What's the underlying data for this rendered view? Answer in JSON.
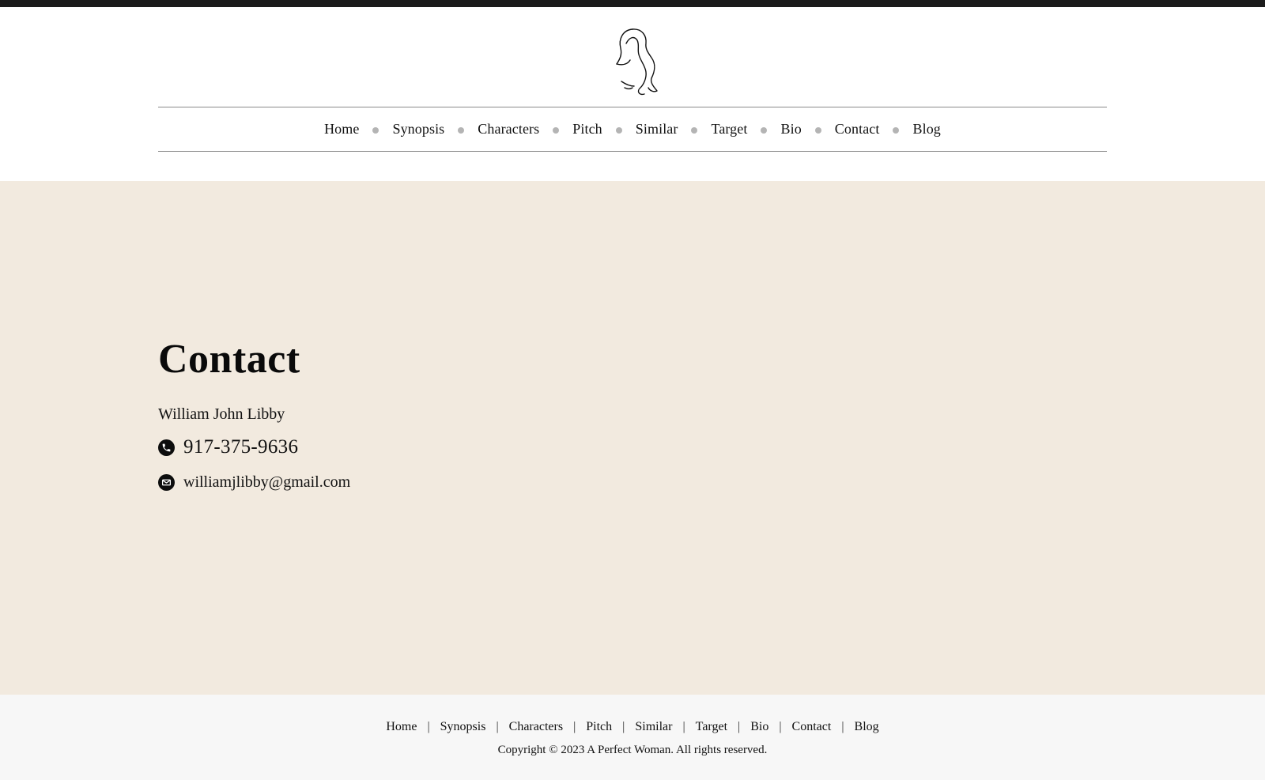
{
  "header": {
    "logo_icon": "woman-silhouette-line-logo",
    "nav": [
      {
        "label": "Home"
      },
      {
        "label": "Synopsis"
      },
      {
        "label": "Characters"
      },
      {
        "label": "Pitch"
      },
      {
        "label": "Similar"
      },
      {
        "label": "Target"
      },
      {
        "label": "Bio"
      },
      {
        "label": "Contact"
      },
      {
        "label": "Blog"
      }
    ]
  },
  "main": {
    "title": "Contact",
    "name": "William John Libby",
    "phone": "917-375-9636",
    "phone_icon": "phone-icon",
    "email": "williamjlibby@gmail.com",
    "email_icon": "mail-icon"
  },
  "footer": {
    "nav": [
      {
        "label": "Home"
      },
      {
        "label": "Synopsis"
      },
      {
        "label": "Characters"
      },
      {
        "label": "Pitch"
      },
      {
        "label": "Similar"
      },
      {
        "label": "Target"
      },
      {
        "label": "Bio"
      },
      {
        "label": "Contact"
      },
      {
        "label": "Blog"
      }
    ],
    "separator": "|",
    "copyright": "Copyright © 2023 A Perfect Woman. All rights reserved."
  },
  "colors": {
    "top_bar": "#1b1b1b",
    "main_bg": "#f2eadf",
    "footer_bg": "#f7f7f7",
    "nav_dot": "#b4b4b4"
  }
}
